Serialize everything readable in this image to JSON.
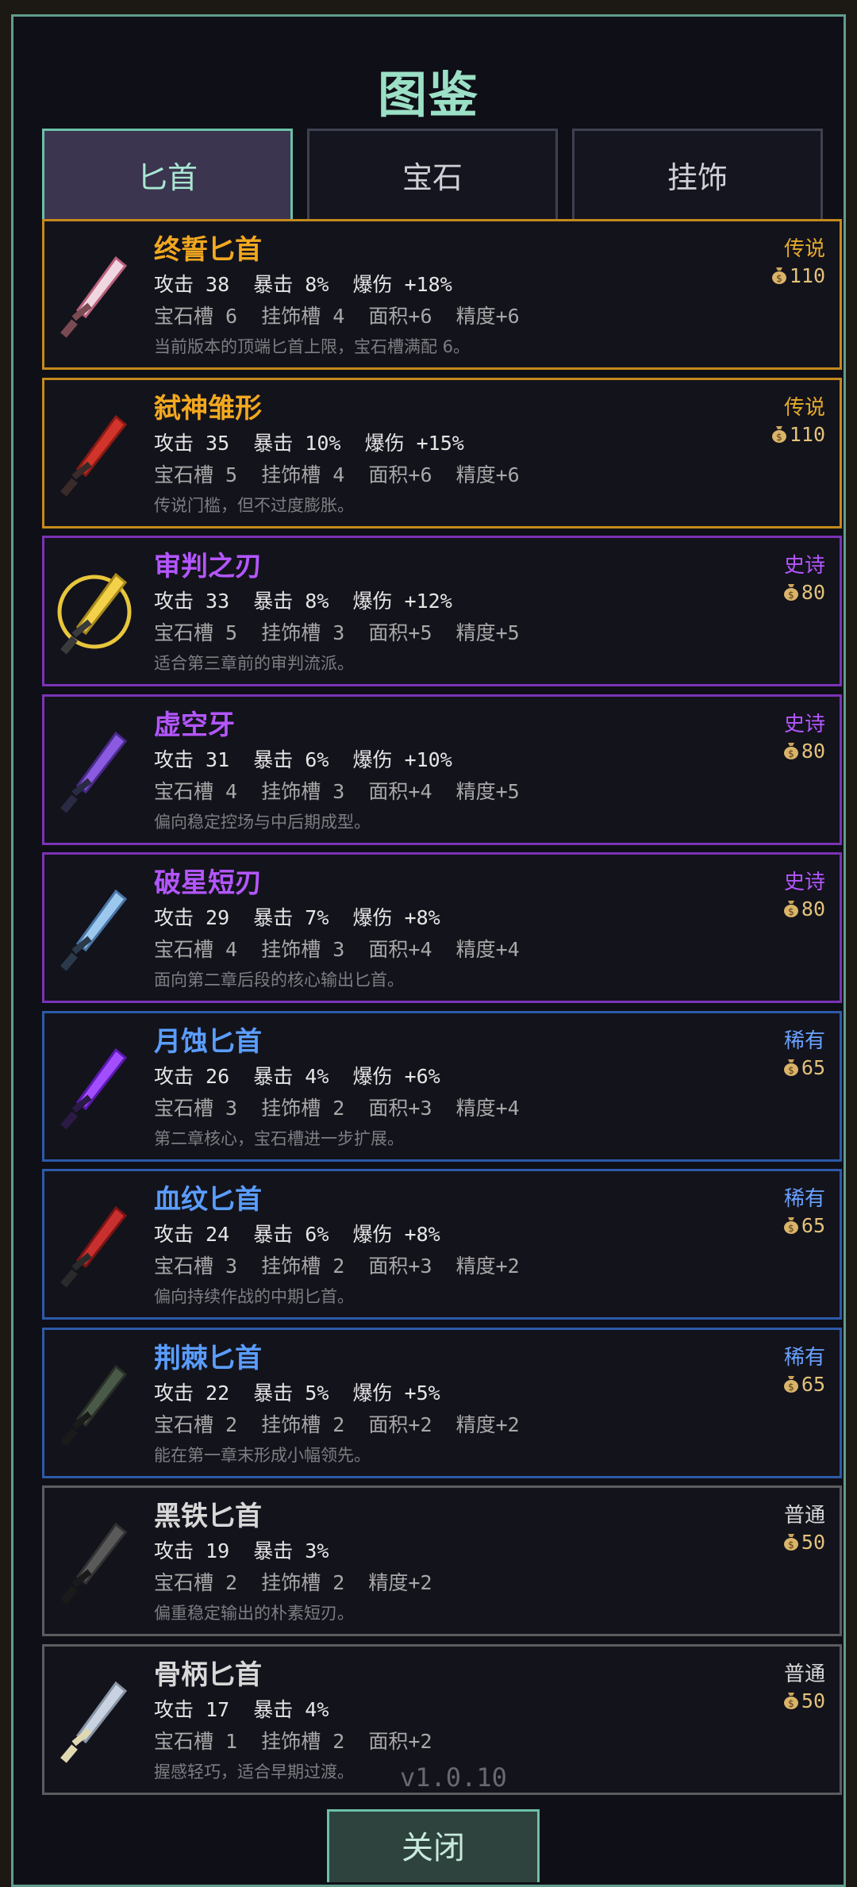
{
  "title": "图鉴",
  "tabs": [
    {
      "label": "匕首",
      "active": true
    },
    {
      "label": "宝石",
      "active": false
    },
    {
      "label": "挂饰",
      "active": false
    }
  ],
  "items": [
    {
      "name": "终誓匕首",
      "rarity": "传说",
      "tier": "legend",
      "price": "110",
      "stats1": "攻击 38  暴击 8%  爆伤 +18%",
      "stats2": "宝石槽 6  挂饰槽 4  面积+6  精度+6",
      "desc": "当前版本的顶端匕首上限，宝石槽满配 6。",
      "icon": "ornate-dagger-icon"
    },
    {
      "name": "弑神雏形",
      "rarity": "传说",
      "tier": "legend",
      "price": "110",
      "stats1": "攻击 35  暴击 10%  爆伤 +15%",
      "stats2": "宝石槽 5  挂饰槽 4  面积+6  精度+6",
      "desc": "传说门槛，但不过度膨胀。",
      "icon": "crimson-blade-icon"
    },
    {
      "name": "审判之刃",
      "rarity": "史诗",
      "tier": "epic",
      "price": "80",
      "stats1": "攻击 33  暴击 8%  爆伤 +12%",
      "stats2": "宝石槽 5  挂饰槽 3  面积+5  精度+5",
      "desc": "适合第三章前的审判流派。",
      "icon": "golden-sword-icon"
    },
    {
      "name": "虚空牙",
      "rarity": "史诗",
      "tier": "epic",
      "price": "80",
      "stats1": "攻击 31  暴击 6%  爆伤 +10%",
      "stats2": "宝石槽 4  挂饰槽 3  面积+4  精度+5",
      "desc": "偏向稳定控场与中后期成型。",
      "icon": "void-fang-icon"
    },
    {
      "name": "破星短刃",
      "rarity": "史诗",
      "tier": "epic",
      "price": "80",
      "stats1": "攻击 29  暴击 7%  爆伤 +8%",
      "stats2": "宝石槽 4  挂饰槽 3  面积+4  精度+4",
      "desc": "面向第二章后段的核心输出匕首。",
      "icon": "crystal-blade-icon"
    },
    {
      "name": "月蚀匕首",
      "rarity": "稀有",
      "tier": "rare",
      "price": "65",
      "stats1": "攻击 26  暴击 4%  爆伤 +6%",
      "stats2": "宝石槽 3  挂饰槽 2  面积+3  精度+4",
      "desc": "第二章核心，宝石槽进一步扩展。",
      "icon": "eclipse-dagger-icon"
    },
    {
      "name": "血纹匕首",
      "rarity": "稀有",
      "tier": "rare",
      "price": "65",
      "stats1": "攻击 24  暴击 6%  爆伤 +8%",
      "stats2": "宝石槽 3  挂饰槽 2  面积+3  精度+2",
      "desc": "偏向持续作战的中期匕首。",
      "icon": "blood-dagger-icon"
    },
    {
      "name": "荆棘匕首",
      "rarity": "稀有",
      "tier": "rare",
      "price": "65",
      "stats1": "攻击 22  暴击 5%  爆伤 +5%",
      "stats2": "宝石槽 2  挂饰槽 2  面积+2  精度+2",
      "desc": "能在第一章末形成小幅领先。",
      "icon": "thorn-dagger-icon"
    },
    {
      "name": "黑铁匕首",
      "rarity": "普通",
      "tier": "common",
      "price": "50",
      "stats1": "攻击 19  暴击 3%",
      "stats2": "宝石槽 2  挂饰槽 2  精度+2",
      "desc": "偏重稳定输出的朴素短刃。",
      "icon": "iron-dagger-icon"
    },
    {
      "name": "骨柄匕首",
      "rarity": "普通",
      "tier": "common",
      "price": "50",
      "stats1": "攻击 17  暴击 4%",
      "stats2": "宝石槽 1  挂饰槽 2  面积+2",
      "desc": "握感轻巧，适合早期过渡。",
      "icon": "bone-dagger-icon"
    }
  ],
  "version": "v1.0.10",
  "close_label": "关闭",
  "colors": {
    "legend": "#f2a81f",
    "epic": "#b456ff",
    "rare": "#5a9dff",
    "common": "#d8d8d8",
    "accent": "#6cc0a6"
  }
}
